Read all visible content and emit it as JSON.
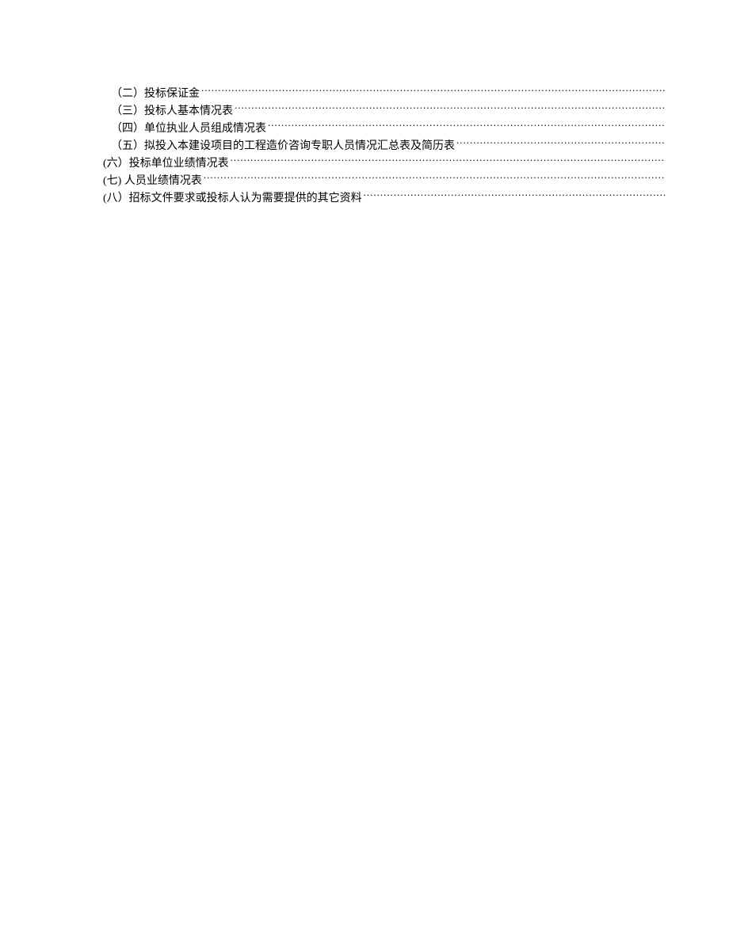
{
  "toc": {
    "items": [
      {
        "label": "（二）投标保证金",
        "indent": true
      },
      {
        "label": "（三）投标人基本情况表",
        "indent": true
      },
      {
        "label": "（四）单位执业人员组成情况表",
        "indent": true
      },
      {
        "label": "（五）拟投入本建设项目的工程造价咨询专职人员情况汇总表及简历表",
        "indent": true
      },
      {
        "label": "(六）投标单位业绩情况表",
        "indent": false
      },
      {
        "label": "(七) 人员业绩情况表",
        "indent": false
      },
      {
        "label": "(八）招标文件要求或投标人认为需要提供的其它资料",
        "indent": false
      }
    ]
  }
}
